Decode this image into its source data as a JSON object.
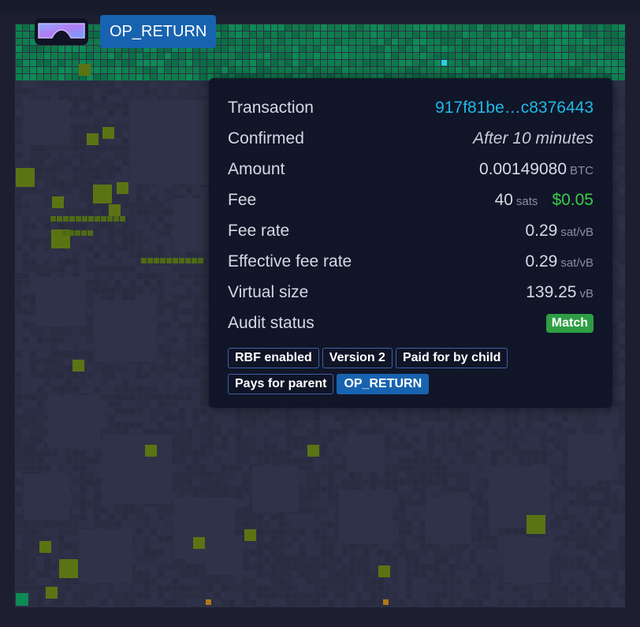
{
  "filter": {
    "chip_label": "OP_RETURN",
    "logo_icon": "goggles-icon"
  },
  "tooltip": {
    "rows": {
      "transaction": {
        "label": "Transaction",
        "value": "917f81be…c8376443"
      },
      "confirmed": {
        "label": "Confirmed",
        "value": "After 10 minutes"
      },
      "amount": {
        "label": "Amount",
        "value": "0.00149080",
        "unit": "BTC"
      },
      "fee": {
        "label": "Fee",
        "value": "40",
        "unit": "sats",
        "fiat": "$0.05"
      },
      "fee_rate": {
        "label": "Fee rate",
        "value": "0.29",
        "unit": "sat/vB"
      },
      "effective_fee_rate": {
        "label": "Effective fee rate",
        "value": "0.29",
        "unit": "sat/vB"
      },
      "virtual_size": {
        "label": "Virtual size",
        "value": "139.25",
        "unit": "vB"
      },
      "audit_status": {
        "label": "Audit status",
        "value": "Match"
      }
    },
    "tags": [
      "RBF enabled",
      "Version 2",
      "Paid for by child",
      "Pays for parent",
      "OP_RETURN"
    ]
  },
  "colors": {
    "link": "#21b9e6",
    "fiat": "#3bcc49",
    "match_badge": "#2e9e44",
    "accent_blue": "#1863b0",
    "block_bg": "#2d3046",
    "tx_green": "#0d8a55",
    "tx_olive": "#5a7414",
    "tx_highlight": "#2ad0e8"
  }
}
